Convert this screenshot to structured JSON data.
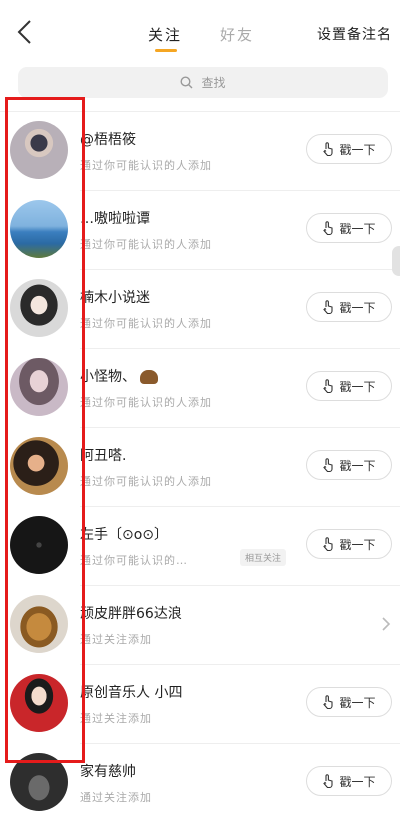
{
  "header": {
    "tabs": [
      {
        "label": "关注",
        "active": true
      },
      {
        "label": "好友",
        "active": false
      }
    ],
    "set_remark": "设置备注名",
    "accent_color": "#f5a623"
  },
  "search": {
    "placeholder": "查找"
  },
  "poke_label": "戳一下",
  "contacts": [
    {
      "name": "@梧梧筱",
      "subtitle": "通过你可能认识的人添加",
      "action": "poke"
    },
    {
      "name": "…嗷啦啦谭",
      "subtitle": "通过你可能认识的人添加",
      "action": "poke"
    },
    {
      "name": "楠木小说迷",
      "subtitle": "通过你可能认识的人添加",
      "action": "poke"
    },
    {
      "name": "小怪物、",
      "subtitle": "通过你可能认识的人添加",
      "action": "poke",
      "emoji": "monkey-face"
    },
    {
      "name": "阿丑嗒.",
      "subtitle": "通过你可能认识的人添加",
      "action": "poke"
    },
    {
      "name": "左手〔⊙o⊙〕",
      "subtitle": "通过你可能认识的…",
      "badge": "相互关注",
      "action": "poke"
    },
    {
      "name": "顽皮胖胖66达浪",
      "subtitle": "通过关注添加",
      "action": "chevron"
    },
    {
      "name": "原创音乐人 小四",
      "subtitle": "通过关注添加",
      "action": "poke"
    },
    {
      "name": "家有慈帅",
      "subtitle": "通过关注添加",
      "action": "poke"
    }
  ],
  "highlight_color": "#e51b1b"
}
